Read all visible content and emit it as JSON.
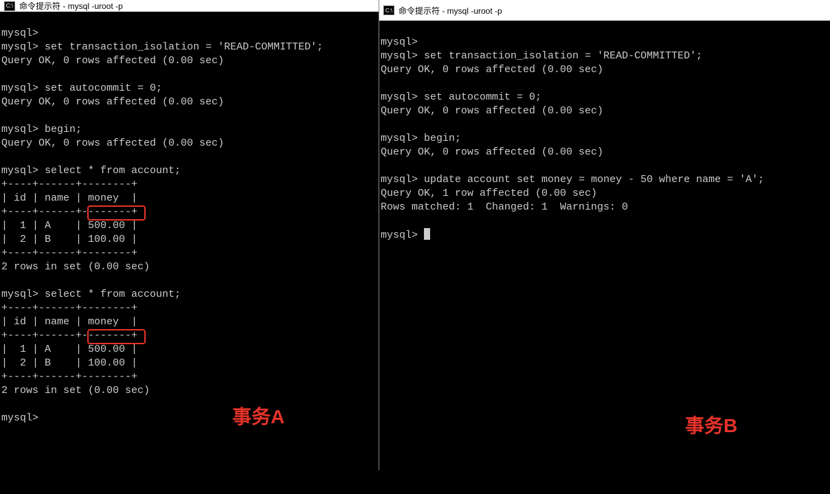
{
  "left": {
    "title": "命令提示符 - mysql  -uroot -p",
    "prompt": "mysql>",
    "cmd_set_isolation": "set transaction_isolation = 'READ-COMMITTED';",
    "resp_ok": "Query OK, 0 rows affected (0.00 sec)",
    "cmd_autocommit": "set autocommit = 0;",
    "cmd_begin": "begin;",
    "cmd_select": "select * from account;",
    "table_border": "+----+------+--------+",
    "table_header": "| id | name | money  |",
    "table_row1": "|  1 | A    | 500.00 |",
    "table_row2": "|  2 | B    | 100.00 |",
    "rows_result": "2 rows in set (0.00 sec)",
    "label": "事务A"
  },
  "right": {
    "title": "命令提示符 - mysql  -uroot -p",
    "prompt": "mysql>",
    "cmd_set_isolation": "set transaction_isolation = 'READ-COMMITTED';",
    "resp_ok": "Query OK, 0 rows affected (0.00 sec)",
    "cmd_autocommit": "set autocommit = 0;",
    "cmd_begin": "begin;",
    "cmd_update": "update account set money = money - 50 where name = 'A';",
    "resp_update": "Query OK, 1 row affected (0.00 sec)",
    "resp_matched": "Rows matched: 1  Changed: 1  Warnings: 0",
    "label": "事务B"
  }
}
